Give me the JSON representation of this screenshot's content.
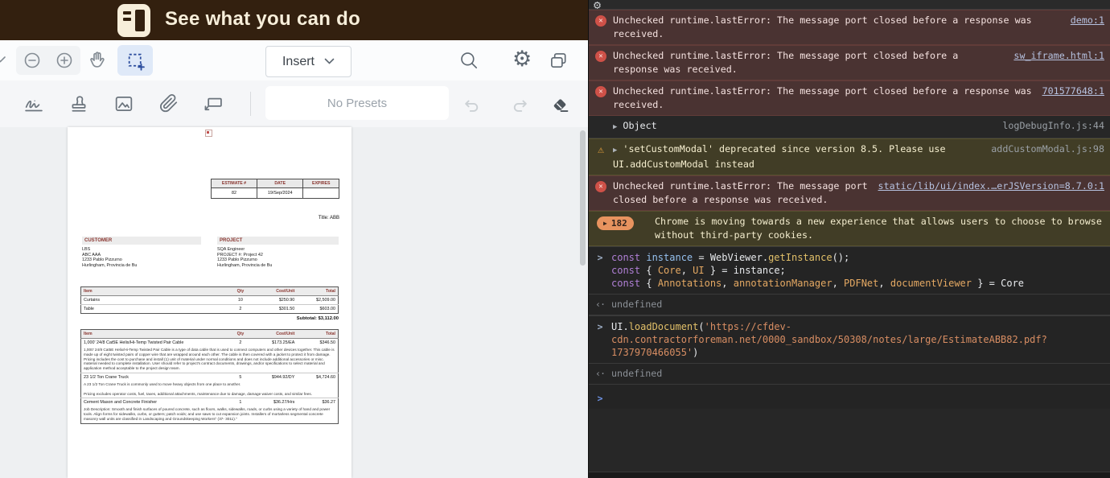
{
  "banner": {
    "title": "See what you can do"
  },
  "toolbar": {
    "insert_label": "Insert",
    "no_presets_label": "No Presets",
    "icons": [
      "chevron-down",
      "zoom-out",
      "zoom-in",
      "pan-hand",
      "marquee-select",
      "search",
      "settings-gear",
      "panels",
      "signature",
      "stamp",
      "image",
      "attachment",
      "callout",
      "undo",
      "redo",
      "eraser"
    ]
  },
  "pdf": {
    "estimate_table": {
      "headers": [
        "ESTIMATE #",
        "DATE",
        "EXPIRES"
      ],
      "values": [
        "82",
        "19/Sep/2024",
        ""
      ]
    },
    "title_line": "Title: ABB",
    "customer": {
      "header": "CUSTOMER",
      "lines": [
        "LBS",
        "ABC AAA",
        "1233 Pablo Pizzurno",
        "Hurlingham, Provincia de Bu"
      ]
    },
    "project": {
      "header": "PROJECT",
      "lines": [
        "SQA Engineer",
        "PROJECT #: Project 42",
        "1233 Pablo Pizzurno",
        "Hurlingham, Provincia de Bu"
      ]
    },
    "items_table_1": {
      "headers": [
        "Item",
        "Qty",
        "Cost/Unit",
        "Total"
      ],
      "rows": [
        {
          "item": "Curtains",
          "qty": "10",
          "cost": "$250.90",
          "total": "$2,509.00"
        },
        {
          "item": "Table",
          "qty": "2",
          "cost": "$301.50",
          "total": "$603.00"
        }
      ],
      "subtotal": "Subtotal: $3,112.00"
    },
    "items_table_2": {
      "headers": [
        "Item",
        "Qty",
        "Cost/Unit",
        "Total"
      ],
      "rows": [
        {
          "item": "1,000' 24/8 Cat5E Helix/Hi-Temp Twisted Pair Cable",
          "qty": "2",
          "cost": "$173.25/EA",
          "total": "$346.50",
          "desc": "1,000' 24/8 Cat5E Helix/Hi-Temp Twisted Pair Cable is a type of data cable that is used to connect computers and other devices together. This cable is made up of eight twisted pairs of copper wire that are wrapped around each other. The cable is then covered with a jacket to protect it from damage. Pricing includes the cost to purchase and install (1) unit of material under normal conditions and does not include additional accessories or misc. material needed to complete installation. User should refer to project's contract documents, drawings, and/or specifications to select material and application method acceptable to the project design team."
        },
        {
          "item": "23 1/2 Ton Crane Truck",
          "qty": "5",
          "cost": "$944.92/DY",
          "total": "$4,724.60",
          "desc": "A 23 1/2 Ton Crane Truck is commonly used to move heavy objects from one place to another.\n\nPricing excludes operator costs, fuel, taxes, additional attachments, maintenance due to damage, damage waiver costs, and similar fees."
        },
        {
          "item": "Cement Mason and Concrete Finisher",
          "qty": "1",
          "cost": "$36.27/Hrs",
          "total": "$36.27",
          "desc": "Job Description: Smooth and finish surfaces of poured concrete, such as floors, walks, sidewalks, roads, or curbs using a variety of hand and power tools. Align forms for sidewalks, curbs, or gutters; patch voids; and use saws to cut expansion joints. Installers of mortarless segmental concrete masonry wall units are classified in Landscaping and Groundskeeping Workers\" (37- 3011).\""
        }
      ]
    }
  },
  "console": {
    "markers": {
      "input": ">",
      "result": "‹·",
      "prompt": ">"
    },
    "entries": [
      {
        "kind": "error",
        "text": "Unchecked runtime.lastError: The message port closed before a response was received.",
        "source": "demo:1",
        "source_is_link": true
      },
      {
        "kind": "error",
        "text": "Unchecked runtime.lastError: The message port closed before a response was received.",
        "source": "sw_iframe.html:1",
        "source_is_link": true
      },
      {
        "kind": "error",
        "text": "Unchecked runtime.lastError: The message port closed before a response was received.",
        "source": "701577648:1",
        "source_is_link": true
      },
      {
        "kind": "log",
        "expand": true,
        "text": "Object",
        "source": "logDebugInfo.js:44"
      },
      {
        "kind": "warning",
        "expand": true,
        "text": "'setCustomModal' deprecated since version 8.5. Please use UI.addCustomModal instead",
        "source": "addCustomModal.js:98"
      },
      {
        "kind": "error",
        "text": "Unchecked runtime.lastError: The message port closed before a response was received.",
        "source": "static/lib/ui/index.…erJSVersion=8.7.0:1",
        "source_is_link": true
      },
      {
        "kind": "count",
        "badge": "182",
        "text": "Chrome is moving towards a new experience that allows users to choose to browse without third-party cookies."
      },
      {
        "kind": "input",
        "lines": [
          [
            [
              "kw",
              "const "
            ],
            [
              "vr",
              "instance"
            ],
            [
              "pl",
              " = WebViewer."
            ],
            [
              "fn",
              "getInstance"
            ],
            [
              "pl",
              "();"
            ]
          ],
          [
            [
              "kw",
              "const "
            ],
            [
              "pl",
              "{ "
            ],
            [
              "pr",
              "Core"
            ],
            [
              "pl",
              ", "
            ],
            [
              "pr",
              "UI"
            ],
            [
              "pl",
              " } = instance;"
            ]
          ],
          [
            [
              "kw",
              "const "
            ],
            [
              "pl",
              "{ "
            ],
            [
              "pr",
              "Annotations"
            ],
            [
              "pl",
              ", "
            ],
            [
              "pr",
              "annotationManager"
            ],
            [
              "pl",
              ", "
            ],
            [
              "pr",
              "PDFNet"
            ],
            [
              "pl",
              ", "
            ],
            [
              "pr",
              "documentViewer"
            ],
            [
              "pl",
              " } = Core"
            ]
          ]
        ]
      },
      {
        "kind": "result",
        "text": "undefined"
      },
      {
        "kind": "input",
        "lines": [
          [
            [
              "pl",
              "UI."
            ],
            [
              "fn",
              "loadDocument"
            ],
            [
              "pl",
              "("
            ],
            [
              "st",
              "'https://cfdev-"
            ]
          ],
          [
            [
              "st",
              "cdn.contractorforeman.net/0000_sandbox/50308/notes/large/EstimateABB82.pdf?"
            ]
          ],
          [
            [
              "st",
              "1737970466055'"
            ],
            [
              "pl",
              ")"
            ]
          ]
        ]
      },
      {
        "kind": "result",
        "text": "undefined"
      },
      {
        "kind": "prompt"
      }
    ]
  }
}
